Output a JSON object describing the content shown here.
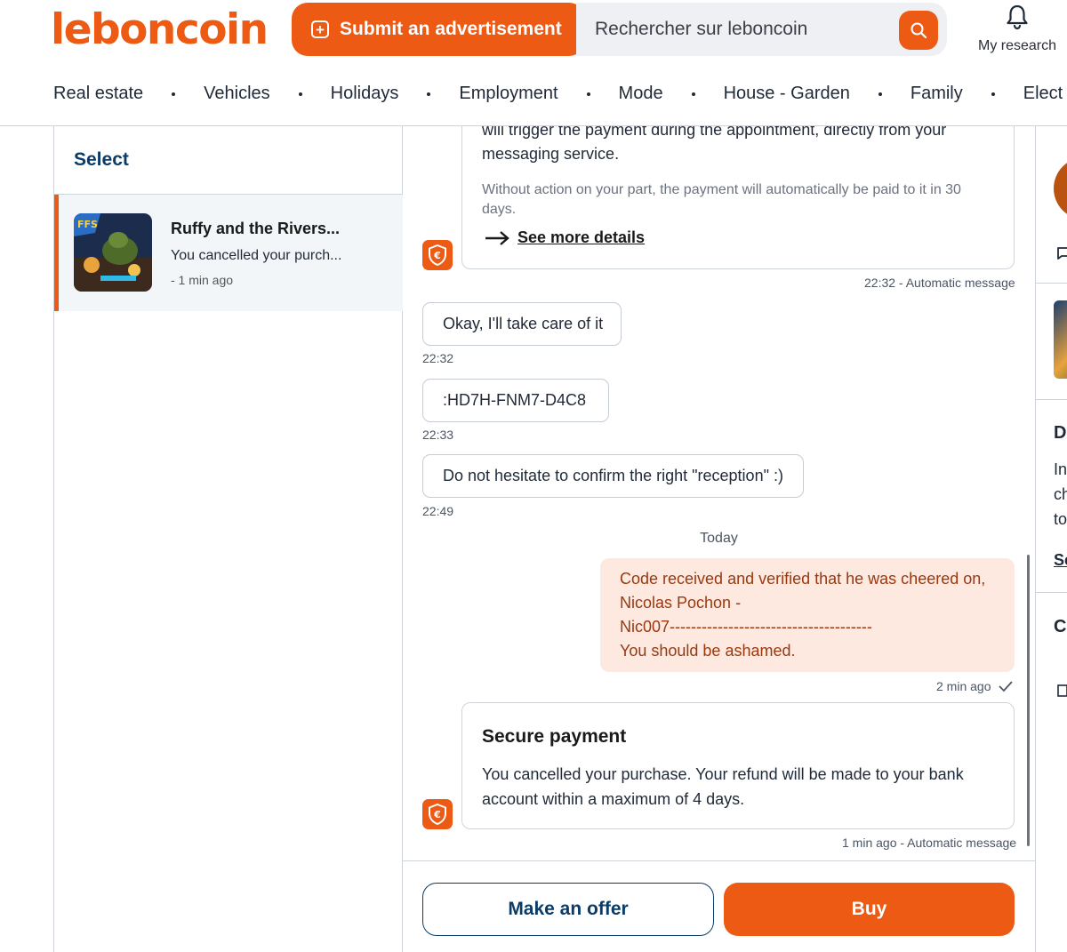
{
  "header": {
    "logo": "leboncoin",
    "submit_label": "Submit an advertisement",
    "search_placeholder": "Rechercher sur leboncoin",
    "research_label": "My research"
  },
  "nav": [
    "Real estate",
    "Vehicles",
    "Holidays",
    "Employment",
    "Mode",
    "House - Garden",
    "Family",
    "Elect"
  ],
  "sidebar": {
    "title": "Select",
    "conversation": {
      "title": "Ruffy and the Rivers...",
      "subtitle": "You cancelled your purch...",
      "time": "- 1 min ago"
    }
  },
  "chat": {
    "card1": {
      "text_top": "will trigger the payment during the appointment, directly from your messaging service.",
      "text_note": "Without action on your part, the payment will automatically be paid to it in 30 days.",
      "link": "See more details",
      "meta": "22:32 - Automatic message"
    },
    "messages": [
      {
        "text": "Okay, I'll take care of it",
        "time": "22:32"
      },
      {
        "text": ":HD7H-FNM7-D4C8",
        "time": "22:33"
      },
      {
        "text": "Do not hesitate to confirm the right \"reception\" :)",
        "time": "22:49"
      }
    ],
    "day_separator": "Today",
    "own_message": {
      "line1": "Code received and verified that he was cheered on,",
      "line2": "Nicolas Pochon -",
      "line3": "Nic007--------------------------------------",
      "line4": "You should be ashamed.",
      "time": "2 min ago"
    },
    "card2": {
      "title": "Secure payment",
      "body": "You cancelled your purchase. Your refund will be made to your bank account within a maximum of 4 days.",
      "meta": "1 min ago - Automatic message"
    }
  },
  "actions": {
    "offer": "Make an offer",
    "buy": "Buy"
  },
  "right_panel": {
    "heading_d": "D",
    "line_in": "In",
    "line_ch": "ch",
    "line_to": "to",
    "link_se": "Se",
    "heading_c": "C"
  },
  "colors": {
    "brand": "#ec5a13",
    "navy": "#0b3c68",
    "own_bubble_bg": "#fde9df",
    "own_bubble_text": "#9a3810"
  }
}
